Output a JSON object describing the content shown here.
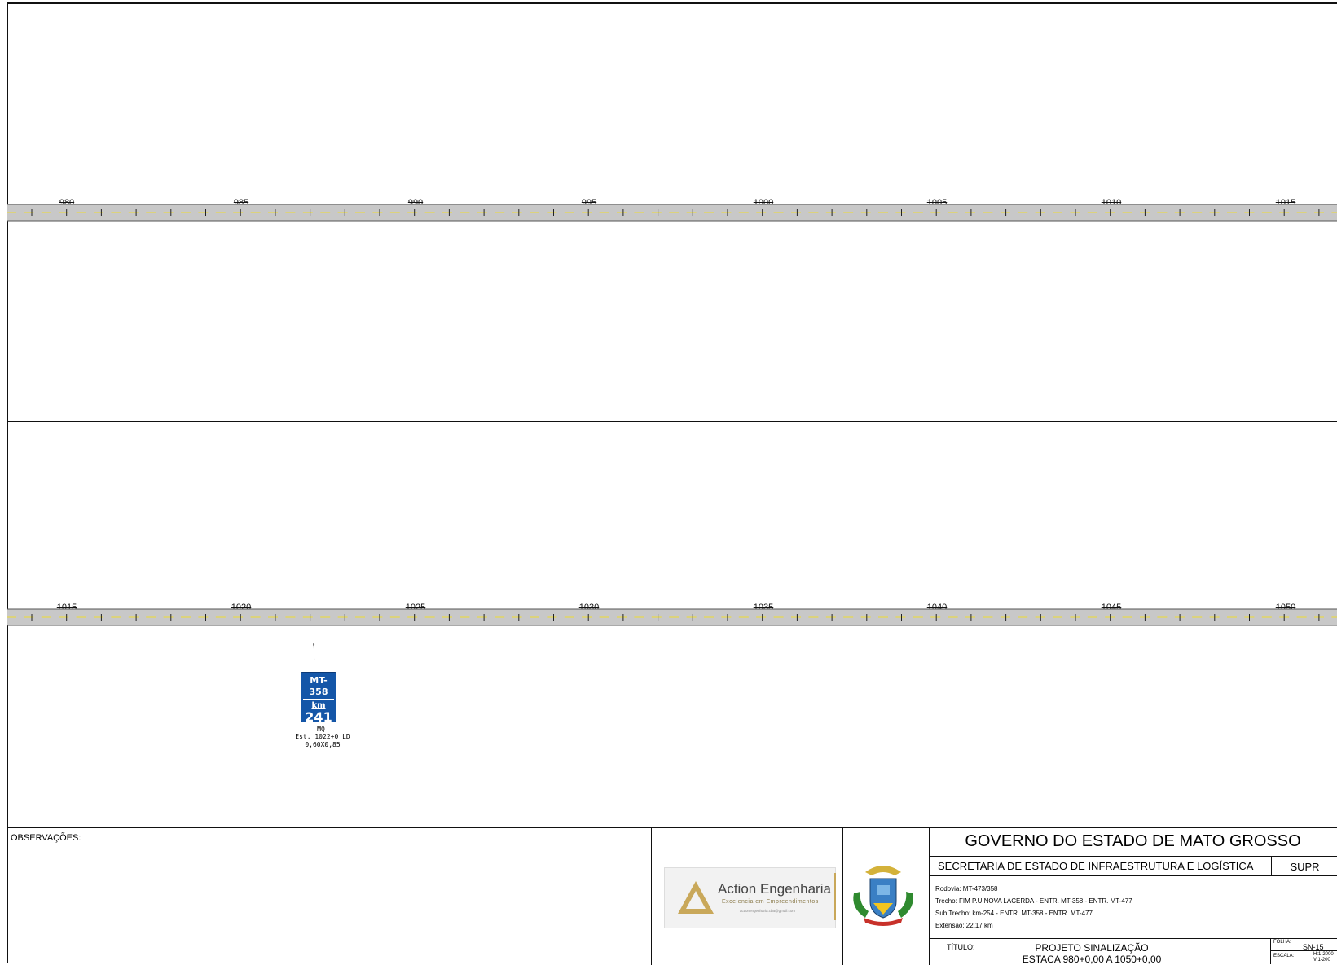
{
  "stations_top": [
    "980",
    "985",
    "990",
    "995",
    "1000",
    "1005",
    "1010",
    "1015"
  ],
  "stations_bottom": [
    "1015",
    "1020",
    "1025",
    "1030",
    "1035",
    "1040",
    "1045",
    "1050"
  ],
  "sign": {
    "highway": "MT-358",
    "km_label": "km",
    "km_value": "241",
    "code": "MQ",
    "station": "Est. 1022+0 LD",
    "size": "0,60X0,85"
  },
  "observations_label": "OBSERVAÇÕES:",
  "company": {
    "name": "Action Engenharia",
    "slogan": "Excelencia em Empreendimentos",
    "email": "actionengenharia.cba@gmail.com"
  },
  "government": "GOVERNO DO ESTADO DE MATO GROSSO",
  "secretariat": "SECRETARIA DE ESTADO DE INFRAESTRUTURA E LOGÍSTICA",
  "department": "SUPR",
  "project_info": {
    "rodovia": "Rodovia: MT-473/358",
    "trecho": "Trecho: FIM P.U NOVA LACERDA - ENTR. MT-358 - ENTR. MT-477",
    "sub_trecho": "Sub Trecho: km-254 - ENTR. MT-358 - ENTR. MT-477",
    "extensao": "Extensão: 22,17 km"
  },
  "title_label": "TÍTULO:",
  "title_line1": "PROJETO SINALIZAÇÃO",
  "title_line2": "ESTACA 980+0,00 A 1050+0,00",
  "sheet_label": "FOLHA:",
  "sheet_value": "SN-15",
  "scale_label": "ESCALA:",
  "scale_h": "H:1-2000",
  "scale_v": "V:1-200",
  "colors": {
    "sign_blue": "#1456a8",
    "road_gray": "#c8c8c8",
    "lane_yellow": "#e8d84a",
    "logo_gold": "#c9a85a"
  }
}
